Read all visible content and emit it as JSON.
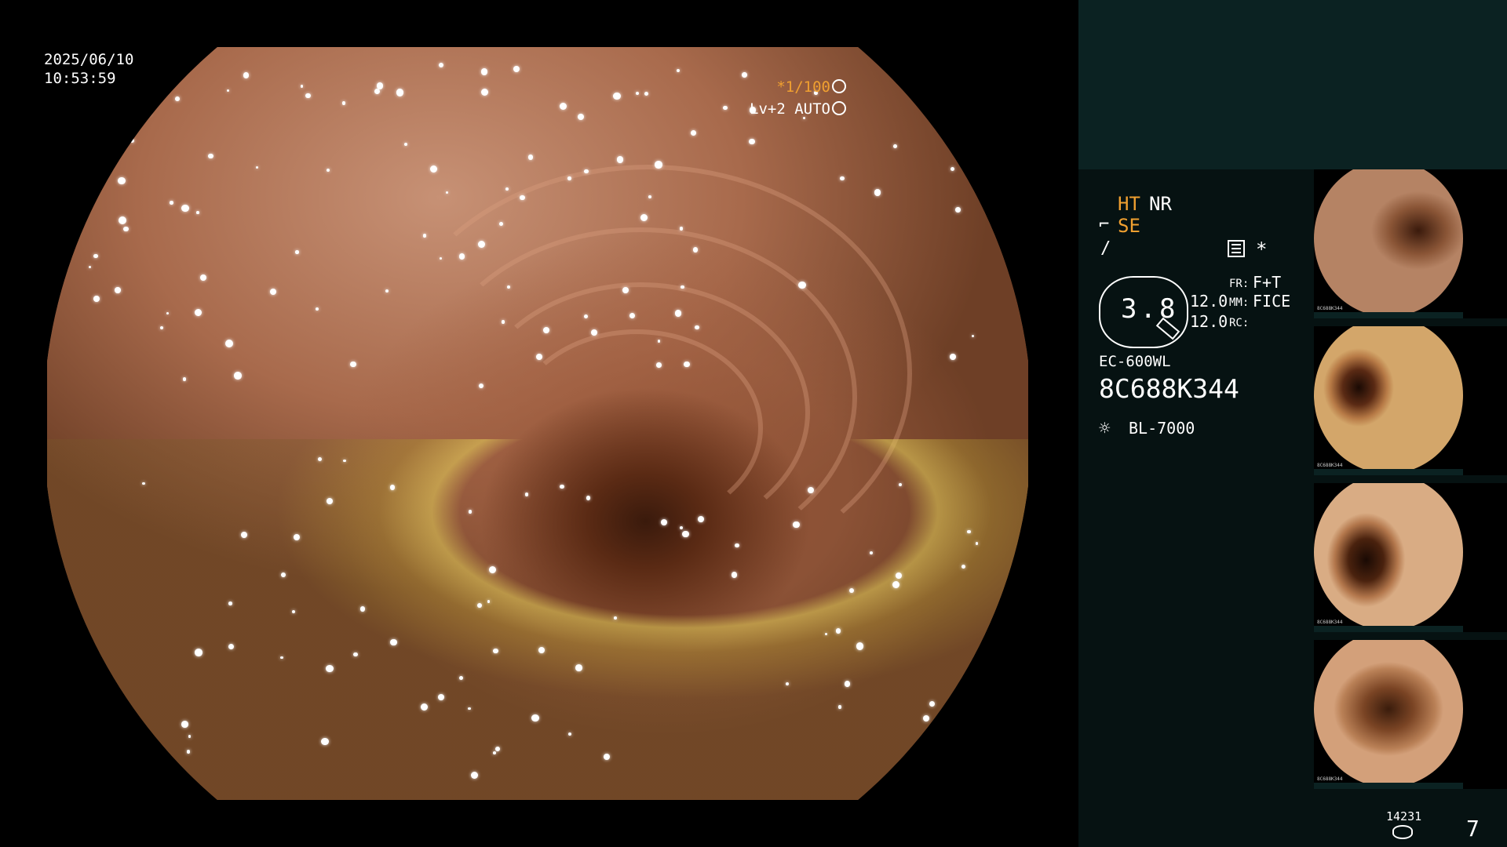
{
  "overlay": {
    "date": "2025/06/10",
    "time": "10:53:59",
    "shutter": "*1/100",
    "light_level": "Lv+2 AUTO"
  },
  "panel": {
    "ht": "HT",
    "nr": "NR",
    "se": "SE",
    "zoom_value": "3.8",
    "value_1": "12.0",
    "value_2": "12.0",
    "fr_label": "FR:",
    "fr_value": "F+T",
    "mm_label": "MM:",
    "mm_value": "FICE",
    "rc_label": "RC:",
    "scope_model": "EC-600WL",
    "serial": "8C688K344",
    "light_source": "BL-7000",
    "small_counter": "14231",
    "image_count": "7"
  },
  "thumbnails": [
    {
      "label": "8C688K344"
    },
    {
      "label": "8C688K344"
    },
    {
      "label": "8C688K344"
    },
    {
      "label": "8C688K344"
    }
  ],
  "colors": {
    "accent_orange": "#f0a030",
    "panel_bg": "#061212",
    "top_strip_bg": "#0b2222"
  },
  "icons": [
    "aperture-icon",
    "iris-icon",
    "structure-enhance-icon",
    "edge-icon",
    "list-icon",
    "star-icon",
    "zoom-hexagon-icon",
    "pen-icon",
    "lightbulb-icon",
    "disk-icon"
  ]
}
